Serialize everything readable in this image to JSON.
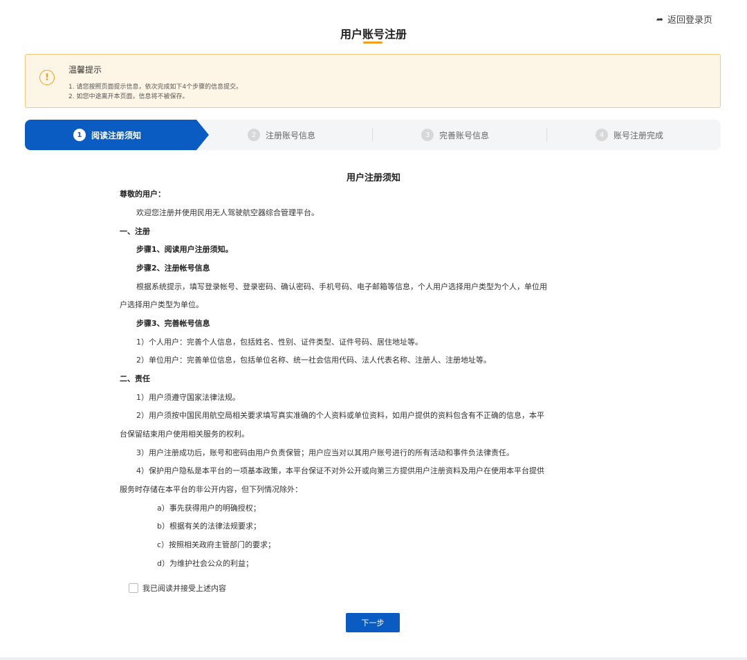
{
  "header": {
    "back_label": "返回登录页",
    "title": "用户账号注册"
  },
  "notice": {
    "title": "温馨提示",
    "lines": [
      "1. 请您按照页面提示信息，依次完成如下4个步骤的信息提交。",
      "2. 如您中途离开本页面，信息将不被保存。"
    ]
  },
  "steps": [
    {
      "num": "1",
      "label": "阅读注册须知"
    },
    {
      "num": "2",
      "label": "注册账号信息"
    },
    {
      "num": "3",
      "label": "完善账号信息"
    },
    {
      "num": "4",
      "label": "账号注册完成"
    }
  ],
  "doc": {
    "title": "用户注册须知",
    "lines": [
      "尊敬的用户：",
      "欢迎您注册并使用民用无人驾驶航空器综合管理平台。",
      "一、注册",
      "步骤1、阅读用户注册须知。",
      "步骤2、注册帐号信息",
      "根据系统提示，填写登录帐号、登录密码、确认密码、手机号码、电子邮箱等信息，个人用户选择用户类型为个人，单位用",
      "户选择用户类型为单位。",
      "步骤3、完善帐号信息",
      "1）个人用户：完善个人信息，包括姓名、性别、证件类型、证件号码、居住地址等。",
      "2）单位用户：完善单位信息，包括单位名称、统一社会信用代码、法人代表名称、注册人、注册地址等。",
      "二、责任",
      "1）用户须遵守国家法律法规。",
      "2）用户须按中国民用航空局相关要求填写真实准确的个人资料或单位资料，如用户提供的资料包含有不正确的信息，本平",
      "台保留结束用户使用相关服务的权利。",
      "3）用户注册成功后，账号和密码由用户负责保管；用户应当对以其用户账号进行的所有活动和事件负法律责任。",
      "4）保护用户隐私是本平台的一项基本政策，本平台保证不对外公开或向第三方提供用户注册资料及用户在使用本平台提供",
      "服务时存储在本平台的非公开内容，但下列情况除外：",
      "a）事先获得用户的明确授权；",
      "b）根据有关的法律法规要求；",
      "c）按照相关政府主管部门的要求；",
      "d）为维护社会公众的利益；"
    ]
  },
  "agree_label": "我已阅读并接受上述内容",
  "next_label": "下一步",
  "colors": {
    "primary": "#0a5cc2",
    "accent": "#f0a020",
    "notice_bg": "#fdf5e6"
  }
}
